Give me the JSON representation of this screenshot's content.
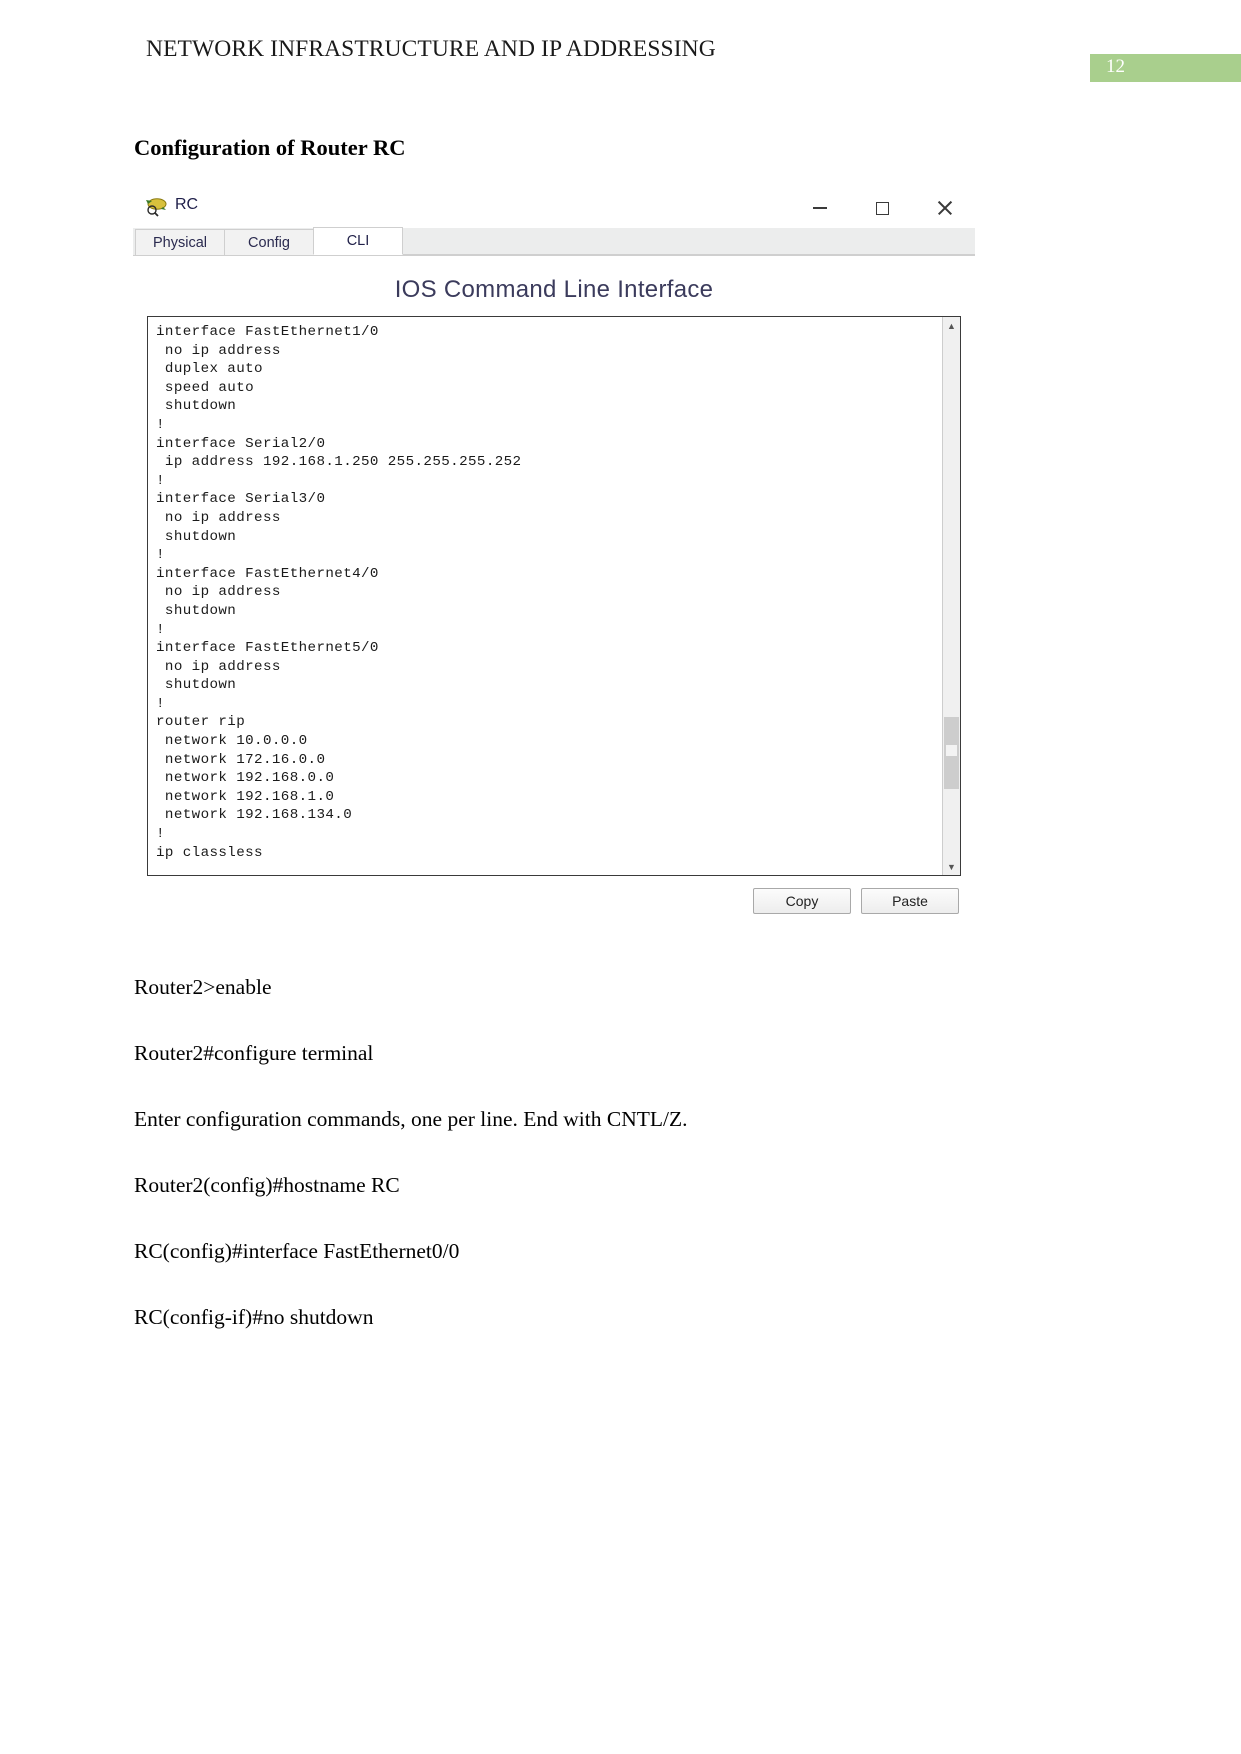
{
  "document": {
    "running_header": "NETWORK INFRASTRUCTURE AND IP ADDRESSING",
    "page_number": "12",
    "page_badge_color": "#a9cf8d",
    "section_heading": "Configuration of Router RC"
  },
  "packet_tracer_window": {
    "title": "RC",
    "title_icon": "router-icon",
    "window_controls": {
      "minimize": "minimize-icon",
      "maximize": "maximize-icon",
      "close": "close-icon"
    },
    "tabs": [
      {
        "label": "Physical",
        "active": false
      },
      {
        "label": "Config",
        "active": false
      },
      {
        "label": "CLI",
        "active": true
      }
    ],
    "cli_title": "IOS Command Line Interface",
    "terminal_text": "interface FastEthernet1/0\n no ip address\n duplex auto\n speed auto\n shutdown\n!\ninterface Serial2/0\n ip address 192.168.1.250 255.255.255.252\n!\ninterface Serial3/0\n no ip address\n shutdown\n!\ninterface FastEthernet4/0\n no ip address\n shutdown\n!\ninterface FastEthernet5/0\n no ip address\n shutdown\n!\nrouter rip\n network 10.0.0.0\n network 172.16.0.0\n network 192.168.0.0\n network 192.168.1.0\n network 192.168.134.0\n!\nip classless",
    "scrollbar": {
      "up_arrow": "chevron-up-icon",
      "down_arrow": "chevron-down-icon"
    },
    "buttons": {
      "copy": "Copy",
      "paste": "Paste"
    }
  },
  "transcript": {
    "lines": [
      "Router2>enable",
      "Router2#configure terminal",
      "Enter configuration commands, one per line. End with CNTL/Z.",
      "Router2(config)#hostname RC",
      "RC(config)#interface FastEthernet0/0",
      "RC(config-if)#no shutdown"
    ]
  }
}
